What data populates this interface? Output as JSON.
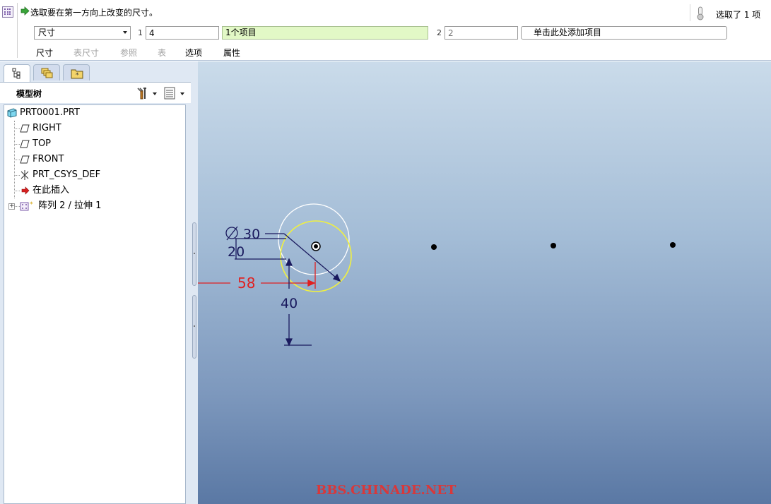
{
  "dashboard": {
    "prompt": "选取要在第一方向上改变的尺寸。",
    "selection_status": "选取了 1 项",
    "type_select": "尺寸",
    "direction1_label": "1",
    "direction1_count": "4",
    "direction1_items": "1个项目",
    "direction2_label": "2",
    "direction2_count_placeholder": "2",
    "add_item": "单击此处添加项目",
    "tabs": [
      {
        "label": "尺寸",
        "enabled": true
      },
      {
        "label": "表尺寸",
        "enabled": false
      },
      {
        "label": "参照",
        "enabled": false
      },
      {
        "label": "表",
        "enabled": false
      },
      {
        "label": "选项",
        "enabled": true
      },
      {
        "label": "属性",
        "enabled": true
      }
    ]
  },
  "model_tree": {
    "title": "模型树",
    "tab_icons": [
      "model-tree-icon",
      "layers-icon",
      "favorites-folder-icon"
    ],
    "nodes": [
      {
        "label": "PRT0001.PRT",
        "icon": "part-icon"
      },
      {
        "label": "RIGHT",
        "icon": "datum-plane-icon"
      },
      {
        "label": "TOP",
        "icon": "datum-plane-icon"
      },
      {
        "label": "FRONT",
        "icon": "datum-plane-icon"
      },
      {
        "label": "PRT_CSYS_DEF",
        "icon": "csys-icon"
      },
      {
        "label": "在此插入",
        "icon": "insert-here-arrow-icon"
      },
      {
        "label": "阵列 2 / 拉伸 1",
        "icon": "pattern-icon"
      }
    ]
  },
  "graphics": {
    "dimensions": {
      "diameter": "30",
      "offset_small": "20",
      "horizontal": "58",
      "vertical": "40"
    },
    "watermark": "BBS.CHINADE.NET",
    "colors": {
      "dimension_dark": "#1a1a5e",
      "dimension_selected": "#e02020",
      "highlight": "#f0f040"
    }
  }
}
